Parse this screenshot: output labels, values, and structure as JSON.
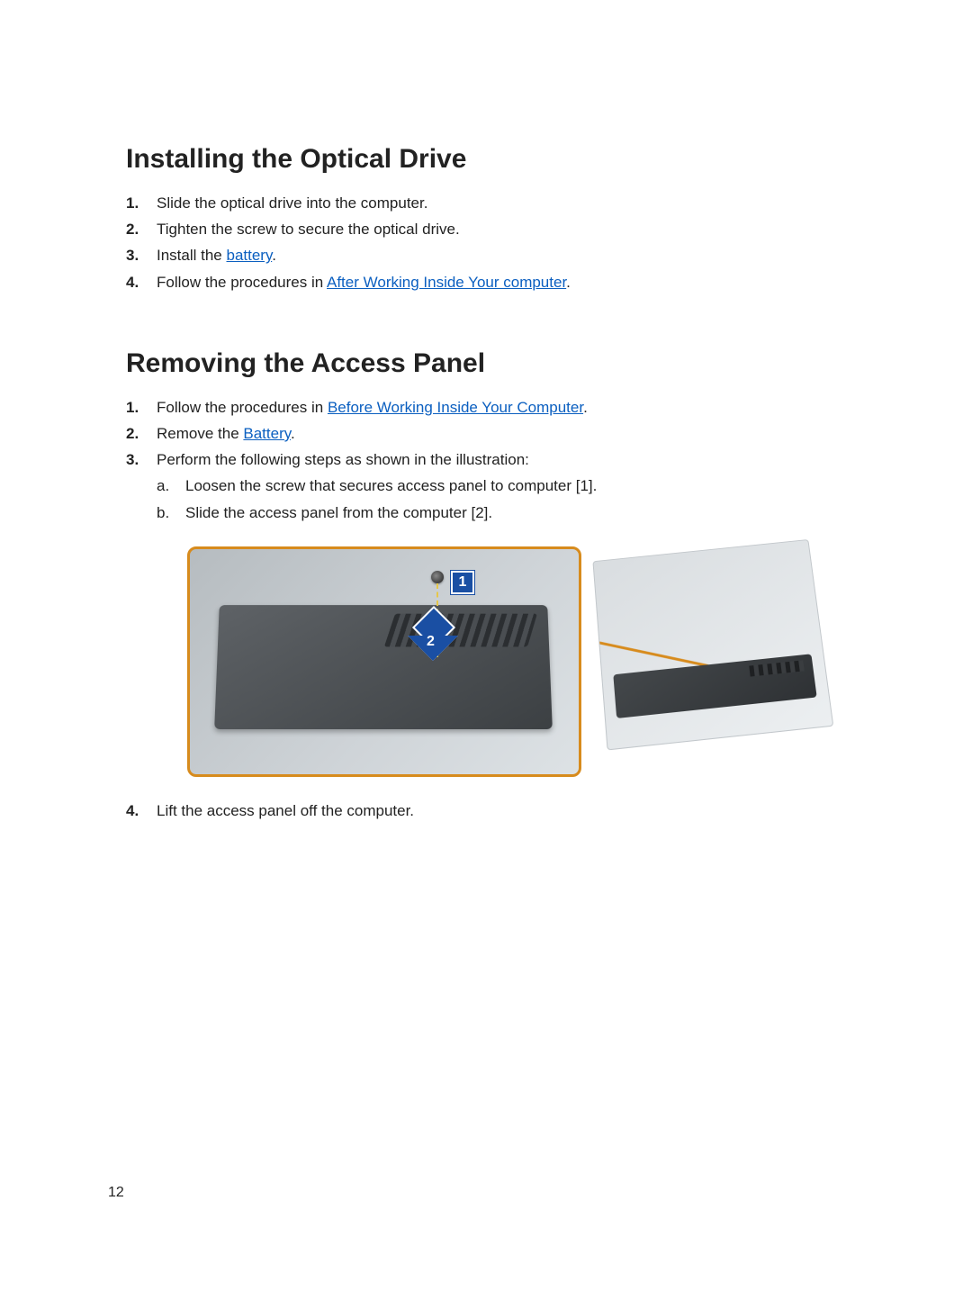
{
  "section1": {
    "heading": "Installing the Optical Drive",
    "steps": {
      "s1": "Slide the optical drive into the computer.",
      "s2": "Tighten the screw to secure the optical drive.",
      "s3_prefix": "Install the ",
      "s3_link": "battery",
      "s3_suffix": ".",
      "s4_prefix": "Follow the procedures in ",
      "s4_link": "After Working Inside Your computer",
      "s4_suffix": "."
    }
  },
  "section2": {
    "heading": "Removing the Access Panel",
    "steps": {
      "s1_prefix": "Follow the procedures in ",
      "s1_link": "Before Working Inside Your Computer",
      "s1_suffix": ".",
      "s2_prefix": "Remove the ",
      "s2_link": "Battery",
      "s2_suffix": ".",
      "s3": "Perform the following steps as shown in the illustration:",
      "sub_a": "Loosen the screw that secures access panel to computer [1].",
      "sub_b": "Slide the access panel from the computer [2].",
      "s4": "Lift the access panel off the computer."
    },
    "badges": {
      "b1": "1",
      "b2": "2"
    }
  },
  "page_number": "12"
}
